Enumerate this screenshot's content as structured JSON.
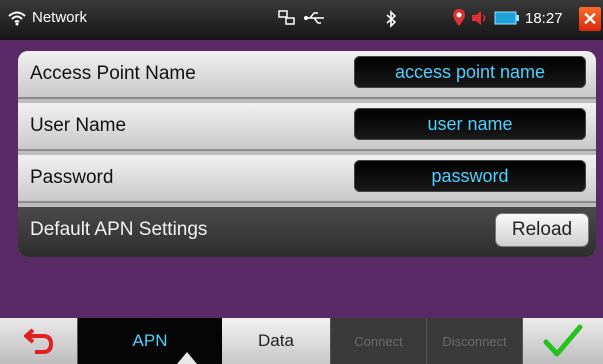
{
  "statusbar": {
    "title": "Network",
    "time": "18:27",
    "icons": [
      "wifi-icon",
      "network-share-icon",
      "usb-icon",
      "bluetooth-icon",
      "gps-icon",
      "volume-icon",
      "battery-icon",
      "close-icon"
    ]
  },
  "form": {
    "apn_label": "Access Point Name",
    "apn_value": "access point name",
    "user_label": "User Name",
    "user_value": "user name",
    "password_label": "Password",
    "password_value": "password",
    "default_label": "Default APN Settings",
    "reload_label": "Reload"
  },
  "toolbar": {
    "apn": "APN",
    "data": "Data",
    "connect": "Connect",
    "disconnect": "Disconnect"
  },
  "colors": {
    "accent": "#4fd0ff",
    "background": "#5a2a67",
    "close": "#e0300e",
    "check": "#27c11e",
    "back": "#e02020"
  }
}
